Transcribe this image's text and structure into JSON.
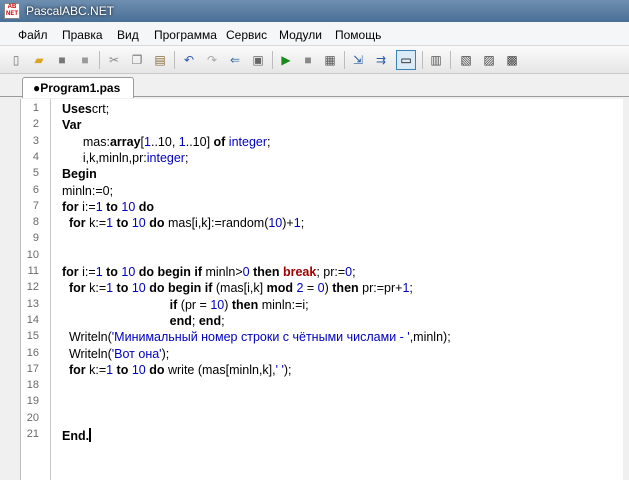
{
  "window": {
    "title": "PascalABC.NET",
    "icon_text": "AB NET"
  },
  "menu": [
    "Файл",
    "Правка",
    "Вид",
    "Программа",
    "Сервис",
    "Модули",
    "Помощь"
  ],
  "toolbar": {
    "icons": [
      "new-file-icon",
      "open-folder-icon",
      "save-icon",
      "save-all-icon",
      "cut-icon",
      "copy-icon",
      "paste-icon",
      "undo-icon",
      "redo-icon",
      "format-code-icon",
      "compile-icon",
      "run-icon",
      "stop-icon",
      "debug-icon",
      "step-into-icon",
      "step-over-icon",
      "output-window-icon",
      "form-designer-icon",
      "dll-icon",
      "help-icon",
      "exit-icon"
    ]
  },
  "tab": {
    "label": "●Program1.pas"
  },
  "editor": {
    "line_numbers": [
      "1",
      "2",
      "3",
      "4",
      "5",
      "6",
      "7",
      "8",
      "9",
      "10",
      "11",
      "12",
      "13",
      "14",
      "15",
      "16",
      "17",
      "18",
      "19",
      "20",
      "21"
    ],
    "lines": [
      [
        [
          "kw",
          "Uses"
        ],
        [
          "",
          "crt;"
        ]
      ],
      [
        [
          "kw",
          "Var"
        ]
      ],
      [
        [
          "",
          "      mas:"
        ],
        [
          "kw",
          "array"
        ],
        [
          "",
          "["
        ],
        [
          "num",
          "1"
        ],
        [
          "",
          "..10, "
        ],
        [
          "num",
          "1"
        ],
        [
          "",
          "..10] "
        ],
        [
          "kw",
          "of"
        ],
        [
          "ty",
          " integer"
        ],
        [
          "",
          ";"
        ]
      ],
      [
        [
          "",
          "      i,k,minln,pr:"
        ],
        [
          "ty",
          "integer"
        ],
        [
          "",
          ";"
        ]
      ],
      [
        [
          "kw",
          "Begin"
        ]
      ],
      [
        [
          "",
          "minln:=0;"
        ]
      ],
      [
        [
          "kw",
          "for"
        ],
        [
          "",
          " i:="
        ],
        [
          "num",
          "1"
        ],
        [
          "kw",
          " to"
        ],
        [
          "num",
          " 10"
        ],
        [
          "kw",
          " do"
        ]
      ],
      [
        [
          "",
          "  "
        ],
        [
          "kw",
          "for"
        ],
        [
          "",
          " k:="
        ],
        [
          "num",
          "1"
        ],
        [
          "kw",
          " to"
        ],
        [
          "num",
          " 10"
        ],
        [
          "kw",
          " do"
        ],
        [
          "",
          " mas[i,k]:=random("
        ],
        [
          "num",
          "10"
        ],
        [
          "",
          ")+"
        ],
        [
          "num",
          "1"
        ],
        [
          "",
          ";"
        ]
      ],
      [],
      [],
      [
        [
          "",
          ""
        ],
        [
          "kw",
          "for"
        ],
        [
          "",
          " i:="
        ],
        [
          "num",
          "1"
        ],
        [
          "kw",
          " to"
        ],
        [
          "num",
          " 10"
        ],
        [
          "kw",
          " do begin if"
        ],
        [
          "",
          " minln>"
        ],
        [
          "num",
          "0"
        ],
        [
          "kw",
          " then"
        ],
        [
          "brk",
          " break"
        ],
        [
          "",
          "; pr:="
        ],
        [
          "num",
          "0"
        ],
        [
          "",
          ";"
        ]
      ],
      [
        [
          "",
          "  "
        ],
        [
          "kw",
          "for"
        ],
        [
          "",
          " k:="
        ],
        [
          "num",
          "1"
        ],
        [
          "kw",
          " to"
        ],
        [
          "num",
          " 10"
        ],
        [
          "kw",
          " do begin if"
        ],
        [
          "",
          " (mas[i,k] "
        ],
        [
          "kw",
          "mod"
        ],
        [
          "",
          " "
        ],
        [
          "num",
          "2"
        ],
        [
          "",
          " = "
        ],
        [
          "num",
          "0"
        ],
        [
          "",
          ") "
        ],
        [
          "kw",
          "then"
        ],
        [
          "",
          " pr:=pr+"
        ],
        [
          "num",
          "1"
        ],
        [
          "",
          ";"
        ]
      ],
      [
        [
          "",
          "                               "
        ],
        [
          "kw",
          "if"
        ],
        [
          "",
          " (pr = "
        ],
        [
          "num",
          "10"
        ],
        [
          "",
          ") "
        ],
        [
          "kw",
          "then"
        ],
        [
          "",
          " minln:=i;"
        ]
      ],
      [
        [
          "",
          "                               "
        ],
        [
          "kw",
          "end"
        ],
        [
          "",
          "; "
        ],
        [
          "kw",
          "end"
        ],
        [
          "",
          ";"
        ]
      ],
      [
        [
          "",
          "  Writeln("
        ],
        [
          "str",
          "'Минимальный номер строки с чётными числами - '"
        ],
        [
          "",
          ",minln);"
        ]
      ],
      [
        [
          "",
          "  Writeln("
        ],
        [
          "str",
          "'Вот она'"
        ],
        [
          "",
          ");"
        ]
      ],
      [
        [
          "",
          "  "
        ],
        [
          "kw",
          "for"
        ],
        [
          "",
          " k:="
        ],
        [
          "num",
          "1"
        ],
        [
          "kw",
          " to"
        ],
        [
          "num",
          " 10"
        ],
        [
          "kw",
          " do"
        ],
        [
          "",
          " write (mas[minln,k],"
        ],
        [
          "str",
          "' '"
        ],
        [
          "",
          ");"
        ]
      ],
      [],
      [],
      [],
      [
        [
          "kw",
          "End."
        ]
      ]
    ]
  }
}
